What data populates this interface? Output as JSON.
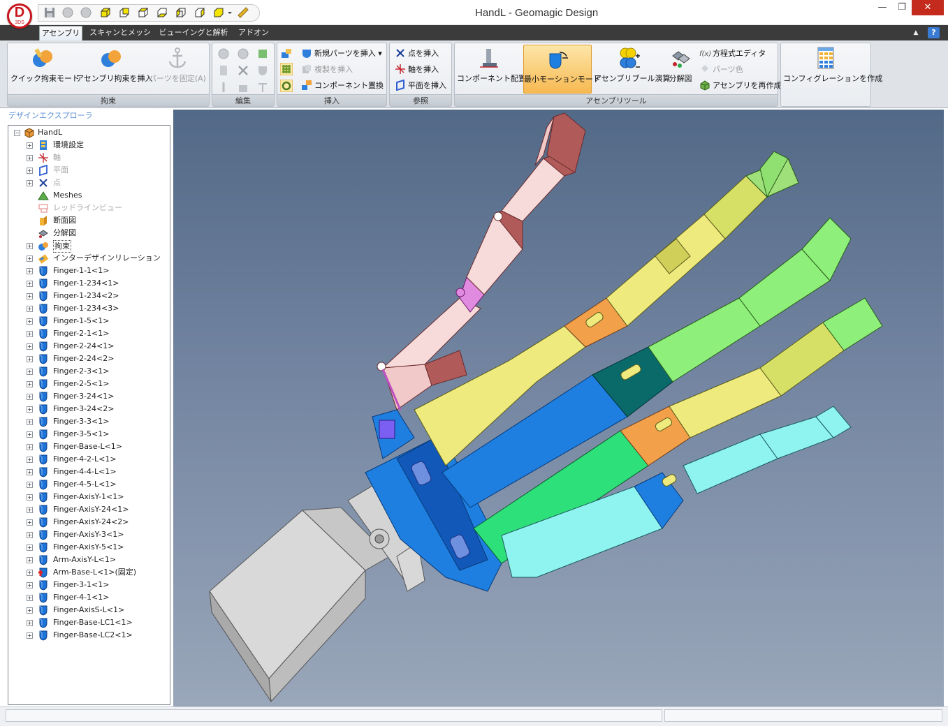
{
  "window": {
    "title": "HandL - Geomagic Design",
    "logo_letter": "D",
    "logo_sub": "3DS",
    "minimize": "—",
    "restore": "❐",
    "close": "✕"
  },
  "quick_access": [
    "save-icon",
    "undo-icon",
    "redo-icon",
    "view-cube-icon",
    "view-cube-icon",
    "view-cube-icon",
    "view-cube-icon",
    "view-cube-icon",
    "view-cube-icon",
    "view-cube-icon",
    "ruler-icon"
  ],
  "tabs": [
    "アセンブリ",
    "スキャンとメッシュ",
    "ビューイングと解析",
    "アドオン"
  ],
  "active_tab": 0,
  "ribbon_right": {
    "collapse": "▲",
    "help": "?"
  },
  "ribbon": {
    "constraint": {
      "label": "拘束",
      "quick_mode": "クイック拘束モード",
      "insert_assembly": "アセンブリ拘束を挿入",
      "fix_part": "パーツを固定(A)"
    },
    "edit": {
      "label": "編集"
    },
    "insert": {
      "label": "挿入",
      "new_part": "新規パーツを挿入",
      "duplicate": "複製を挿入",
      "replace": "コンポーネント置換"
    },
    "reference": {
      "label": "参照",
      "point": "点を挿入",
      "axis": "軸を挿入",
      "plane": "平面を挿入"
    },
    "assembly_tools": {
      "label": "アセンブリツール",
      "component_layout": "コンポーネント配置",
      "min_motion": "最小モーションモード",
      "boolean": "アセンブリブール演算",
      "exploded": "分解図",
      "equation": "方程式エディタ",
      "part_color": "パーツ色",
      "rebuild": "アセンブリを再作成"
    },
    "config": {
      "create": "コンフィグレーションを作成"
    }
  },
  "explorer": {
    "title": "デザインエクスプローラ",
    "tree": [
      {
        "label": "HandL",
        "icon": "assembly-icon",
        "level": 0,
        "pm": "−",
        "style": ""
      },
      {
        "label": "環境設定",
        "icon": "settings-icon",
        "level": 1,
        "pm": "+",
        "style": ""
      },
      {
        "label": "軸",
        "icon": "axis-icon",
        "level": 1,
        "pm": "+",
        "style": "grey"
      },
      {
        "label": "平面",
        "icon": "plane-icon",
        "level": 1,
        "pm": "+",
        "style": "grey"
      },
      {
        "label": "点",
        "icon": "point-icon",
        "level": 1,
        "pm": "+",
        "style": "grey"
      },
      {
        "label": "Meshes",
        "icon": "mesh-icon",
        "level": 1,
        "pm": "",
        "style": ""
      },
      {
        "label": "レッドラインビュー",
        "icon": "redline-icon",
        "level": 1,
        "pm": "",
        "style": "grey"
      },
      {
        "label": "断面図",
        "icon": "section-icon",
        "level": 1,
        "pm": "",
        "style": ""
      },
      {
        "label": "分解図",
        "icon": "explode-icon",
        "level": 1,
        "pm": "",
        "style": ""
      },
      {
        "label": "拘束",
        "icon": "constraint-icon",
        "level": 1,
        "pm": "+",
        "style": "boxed"
      },
      {
        "label": "インターデザインリレーション",
        "icon": "relation-icon",
        "level": 1,
        "pm": "+",
        "style": ""
      },
      {
        "label": "Finger-1-1<1>",
        "icon": "part-icon",
        "level": 1,
        "pm": "+",
        "style": ""
      },
      {
        "label": "Finger-1-234<1>",
        "icon": "part-icon",
        "level": 1,
        "pm": "+",
        "style": ""
      },
      {
        "label": "Finger-1-234<2>",
        "icon": "part-icon",
        "level": 1,
        "pm": "+",
        "style": ""
      },
      {
        "label": "Finger-1-234<3>",
        "icon": "part-icon",
        "level": 1,
        "pm": "+",
        "style": ""
      },
      {
        "label": "Finger-1-5<1>",
        "icon": "part-icon",
        "level": 1,
        "pm": "+",
        "style": ""
      },
      {
        "label": "Finger-2-1<1>",
        "icon": "part-icon",
        "level": 1,
        "pm": "+",
        "style": ""
      },
      {
        "label": "Finger-2-24<1>",
        "icon": "part-icon",
        "level": 1,
        "pm": "+",
        "style": ""
      },
      {
        "label": "Finger-2-24<2>",
        "icon": "part-icon",
        "level": 1,
        "pm": "+",
        "style": ""
      },
      {
        "label": "Finger-2-3<1>",
        "icon": "part-icon",
        "level": 1,
        "pm": "+",
        "style": ""
      },
      {
        "label": "Finger-2-5<1>",
        "icon": "part-icon",
        "level": 1,
        "pm": "+",
        "style": ""
      },
      {
        "label": "Finger-3-24<1>",
        "icon": "part-icon",
        "level": 1,
        "pm": "+",
        "style": ""
      },
      {
        "label": "Finger-3-24<2>",
        "icon": "part-icon",
        "level": 1,
        "pm": "+",
        "style": ""
      },
      {
        "label": "Finger-3-3<1>",
        "icon": "part-icon",
        "level": 1,
        "pm": "+",
        "style": ""
      },
      {
        "label": "Finger-3-5<1>",
        "icon": "part-icon",
        "level": 1,
        "pm": "+",
        "style": ""
      },
      {
        "label": "Finger-Base-L<1>",
        "icon": "part-icon",
        "level": 1,
        "pm": "+",
        "style": ""
      },
      {
        "label": "Finger-4-2-L<1>",
        "icon": "part-icon",
        "level": 1,
        "pm": "+",
        "style": ""
      },
      {
        "label": "Finger-4-4-L<1>",
        "icon": "part-icon",
        "level": 1,
        "pm": "+",
        "style": ""
      },
      {
        "label": "Finger-4-5-L<1>",
        "icon": "part-icon",
        "level": 1,
        "pm": "+",
        "style": ""
      },
      {
        "label": "Finger-AxisY-1<1>",
        "icon": "part-icon",
        "level": 1,
        "pm": "+",
        "style": ""
      },
      {
        "label": "Finger-AxisY-24<1>",
        "icon": "part-icon",
        "level": 1,
        "pm": "+",
        "style": ""
      },
      {
        "label": "Finger-AxisY-24<2>",
        "icon": "part-icon",
        "level": 1,
        "pm": "+",
        "style": ""
      },
      {
        "label": "Finger-AxisY-3<1>",
        "icon": "part-icon",
        "level": 1,
        "pm": "+",
        "style": ""
      },
      {
        "label": "Finger-AxisY-5<1>",
        "icon": "part-icon",
        "level": 1,
        "pm": "+",
        "style": ""
      },
      {
        "label": "Arm-AxisY-L<1>",
        "icon": "part-icon",
        "level": 1,
        "pm": "+",
        "style": ""
      },
      {
        "label": "Arm-Base-L<1>(固定)",
        "icon": "fixed-part-icon",
        "level": 1,
        "pm": "+",
        "style": ""
      },
      {
        "label": "Finger-3-1<1>",
        "icon": "part-icon",
        "level": 1,
        "pm": "+",
        "style": ""
      },
      {
        "label": "Finger-4-1<1>",
        "icon": "part-icon",
        "level": 1,
        "pm": "+",
        "style": ""
      },
      {
        "label": "Finger-AxisS-L<1>",
        "icon": "part-icon",
        "level": 1,
        "pm": "+",
        "style": ""
      },
      {
        "label": "Finger-Base-LC1<1>",
        "icon": "part-icon",
        "level": 1,
        "pm": "+",
        "style": ""
      },
      {
        "label": "Finger-Base-LC2<1>",
        "icon": "part-icon",
        "level": 1,
        "pm": "+",
        "style": ""
      }
    ]
  },
  "viewport": {
    "model_colors": {
      "thumb": "#f2c9c9",
      "index": "#eeea7e",
      "middle": "#1e7fe0",
      "ring": "#8ef07a",
      "little": "#8ff4f0",
      "arm": "#d9d9d9"
    }
  }
}
